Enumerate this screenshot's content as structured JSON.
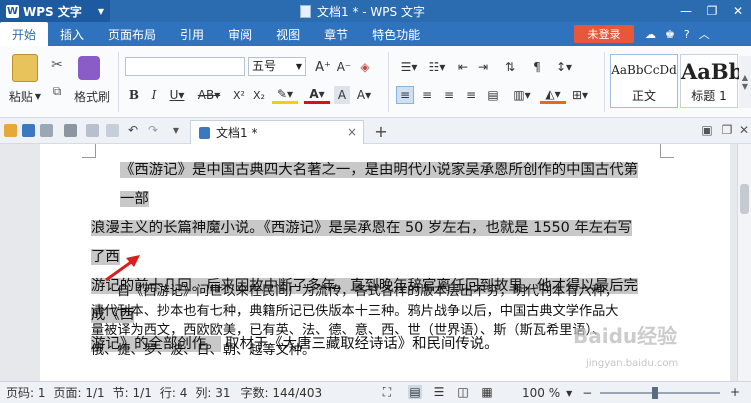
{
  "app": {
    "name": "WPS 文字",
    "window_title": "文档1 * - WPS 文字"
  },
  "menu": {
    "tabs": [
      "开始",
      "插入",
      "页面布局",
      "引用",
      "审阅",
      "视图",
      "章节",
      "特色功能"
    ],
    "login": "未登录"
  },
  "ribbon": {
    "paste": "粘贴",
    "format_painter": "格式刷",
    "font_size": "五号",
    "styles": [
      {
        "sample": "AaBbCcDd",
        "label": "正文"
      },
      {
        "sample": "AaBb",
        "label": "标题 1"
      }
    ]
  },
  "doc_tab": {
    "title": "文档1 *"
  },
  "document": {
    "para1_lines": [
      "《西游记》是中国古典四大名著之一，是由明代小说家吴承恩所创作的中国古代第一部",
      "浪漫主义的长篇神魔小说。《西游记》是吴承恩在 50 岁左右，也就是 1550 年左右写了西",
      "游记的前十几回。后来因故中断了多年，直到晚年辞官离任回到故里，他才得以最后完成《西",
      "游记》的全部创作。"
    ],
    "para1_tail": " 取材于《大唐三藏取经诗话》和民间传说。",
    "para2_lines": [
      "自《西游记》问世以来在民间广为流传，各式各样的版本层出不穷，明代刊本有六种，",
      "清代刊本、抄本也有七种，典籍所记已佚版本十三种。鸦片战争以后，中国古典文学作品大",
      "量被译为西文，西欧欧美，已有英、法、德、意、西、世（世界语）、斯（斯瓦希里语）、",
      "俄、捷、罗、波、日、朝、越等文种。"
    ]
  },
  "watermark": {
    "text": "Baidu经验",
    "url": "jingyan.baidu.com"
  },
  "status": {
    "page_num": "页码: 1",
    "pages": "页面: 1/1",
    "section": "节: 1/1",
    "row": "行: 4",
    "col": "列: 31",
    "chars": "字数: 144/403",
    "zoom": "100 %"
  }
}
